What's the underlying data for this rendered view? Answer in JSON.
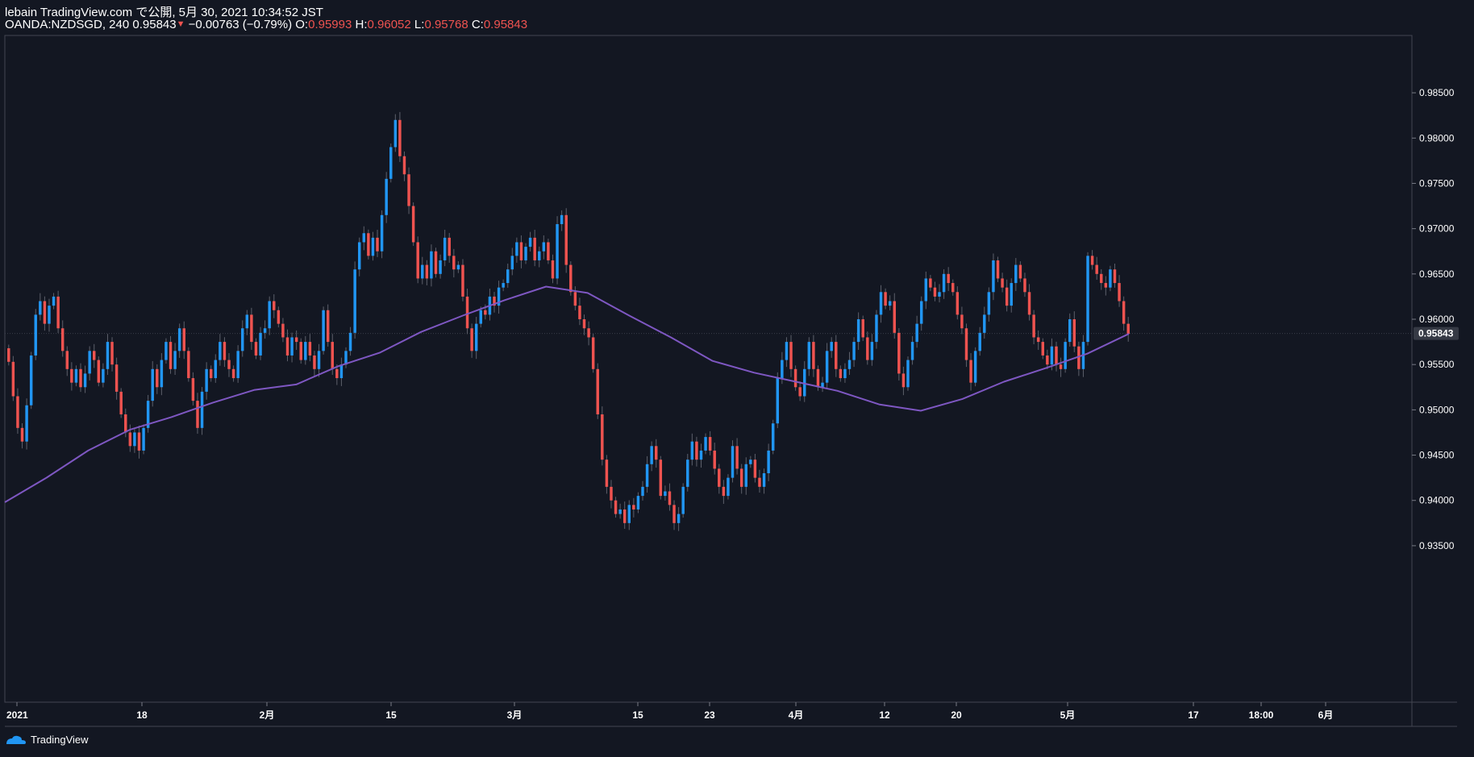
{
  "header": {
    "line1": "lebain TradingView.com で公開, 5月 30, 2021 10:34:52 JST",
    "symbol_info": "OANDA:NZDSGD, 240 0.95843",
    "change": "−0.00763 (−0.79%)",
    "o_label": "O:",
    "o_value": "0.95993",
    "h_label": "H:",
    "h_value": "0.96052",
    "l_label": "L:",
    "l_value": "0.95768",
    "c_label": "C:",
    "c_value": "0.95843"
  },
  "footer": {
    "brand": "TradingView"
  },
  "colors": {
    "background": "#131722",
    "up": "#2196f3",
    "down": "#ef5350",
    "ma": "#7e57c2",
    "grid_border": "#363a45",
    "last_price_tag": "#363a45"
  },
  "chart_data": {
    "type": "line",
    "symbol": "OANDA:NZDSGD",
    "interval": "240",
    "ylim": [
      0.9325,
      0.99
    ],
    "y_ticks": [
      "0.98500",
      "0.98000",
      "0.97500",
      "0.97000",
      "0.96500",
      "0.96000",
      "0.95500",
      "0.95000",
      "0.94500",
      "0.94000",
      "0.93500"
    ],
    "last_price": "0.95843",
    "x_ticks": [
      "2021",
      "18",
      "2月",
      "15",
      "3月",
      "15",
      "23",
      "4月",
      "12",
      "20",
      "5月",
      "17",
      "18:00",
      "6月"
    ],
    "series": [
      {
        "style": "candles",
        "close": [
          0.9553,
          0.9515,
          0.948,
          0.9465,
          0.9505,
          0.956,
          0.9605,
          0.962,
          0.9595,
          0.9615,
          0.9625,
          0.959,
          0.9565,
          0.9545,
          0.953,
          0.9545,
          0.9525,
          0.954,
          0.9565,
          0.9555,
          0.953,
          0.9545,
          0.9575,
          0.955,
          0.952,
          0.9495,
          0.9475,
          0.946,
          0.9475,
          0.9455,
          0.948,
          0.951,
          0.9545,
          0.9525,
          0.9555,
          0.9575,
          0.9545,
          0.9565,
          0.959,
          0.9565,
          0.9535,
          0.951,
          0.948,
          0.952,
          0.9545,
          0.9535,
          0.9555,
          0.9575,
          0.9555,
          0.9545,
          0.9535,
          0.9565,
          0.959,
          0.9605,
          0.9575,
          0.956,
          0.9585,
          0.959,
          0.962,
          0.961,
          0.9595,
          0.958,
          0.956,
          0.958,
          0.9575,
          0.9555,
          0.9575,
          0.956,
          0.9545,
          0.9565,
          0.961,
          0.9575,
          0.9545,
          0.9535,
          0.955,
          0.9565,
          0.9585,
          0.9655,
          0.9685,
          0.9695,
          0.967,
          0.969,
          0.9675,
          0.9715,
          0.9755,
          0.979,
          0.982,
          0.978,
          0.976,
          0.9725,
          0.9685,
          0.9645,
          0.966,
          0.9645,
          0.9675,
          0.965,
          0.9665,
          0.969,
          0.967,
          0.9655,
          0.966,
          0.9625,
          0.959,
          0.9565,
          0.9595,
          0.961,
          0.9605,
          0.9625,
          0.9615,
          0.9635,
          0.964,
          0.9655,
          0.967,
          0.9685,
          0.9665,
          0.968,
          0.969,
          0.9665,
          0.9675,
          0.9685,
          0.9665,
          0.9645,
          0.9705,
          0.9715,
          0.966,
          0.963,
          0.9615,
          0.96,
          0.959,
          0.958,
          0.9545,
          0.9495,
          0.9445,
          0.9415,
          0.94,
          0.9385,
          0.939,
          0.9375,
          0.9395,
          0.939,
          0.9405,
          0.9415,
          0.944,
          0.946,
          0.9445,
          0.9405,
          0.941,
          0.9395,
          0.9375,
          0.9385,
          0.9415,
          0.9445,
          0.9465,
          0.9445,
          0.9455,
          0.947,
          0.9455,
          0.9435,
          0.9415,
          0.9405,
          0.9425,
          0.946,
          0.9435,
          0.9415,
          0.944,
          0.9445,
          0.9425,
          0.9415,
          0.943,
          0.9455,
          0.9485,
          0.9535,
          0.9555,
          0.9575,
          0.9545,
          0.9525,
          0.9515,
          0.9545,
          0.9575,
          0.9545,
          0.9525,
          0.953,
          0.9565,
          0.9575,
          0.9545,
          0.9535,
          0.9545,
          0.9555,
          0.9575,
          0.96,
          0.958,
          0.9555,
          0.9575,
          0.9605,
          0.963,
          0.9615,
          0.962,
          0.9585,
          0.954,
          0.9525,
          0.9555,
          0.9575,
          0.9595,
          0.962,
          0.9645,
          0.9635,
          0.9625,
          0.963,
          0.965,
          0.964,
          0.963,
          0.9605,
          0.959,
          0.9555,
          0.953,
          0.9565,
          0.9585,
          0.9605,
          0.963,
          0.9665,
          0.9645,
          0.9635,
          0.9615,
          0.964,
          0.966,
          0.9645,
          0.963,
          0.9605,
          0.958,
          0.9575,
          0.956,
          0.955,
          0.957,
          0.955,
          0.9545,
          0.9575,
          0.96,
          0.957,
          0.9545,
          0.9575,
          0.967,
          0.966,
          0.965,
          0.964,
          0.9635,
          0.9655,
          0.964,
          0.962,
          0.9595,
          0.9584
        ]
      },
      {
        "style": "moving-average",
        "values": [
          0.9398,
          0.9425,
          0.9455,
          0.9478,
          0.9492,
          0.9508,
          0.9522,
          0.9528,
          0.9548,
          0.9563,
          0.9586,
          0.9604,
          0.9621,
          0.9636,
          0.9629,
          0.9604,
          0.958,
          0.9554,
          0.9541,
          0.9531,
          0.9521,
          0.9506,
          0.9499,
          0.9512,
          0.9531,
          0.9546,
          0.9562,
          0.9584
        ]
      }
    ]
  }
}
